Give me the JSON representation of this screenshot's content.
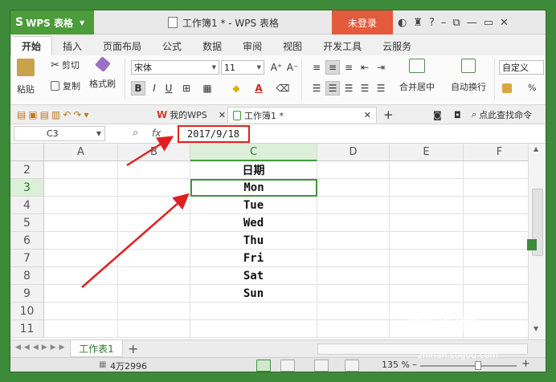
{
  "titlebar": {
    "app_name": "WPS 表格",
    "doc_title": "工作簿1 * - WPS 表格",
    "login_label": "未登录"
  },
  "ribbon_tabs": [
    "开始",
    "插入",
    "页面布局",
    "公式",
    "数据",
    "审阅",
    "视图",
    "开发工具",
    "云服务"
  ],
  "ribbon": {
    "paste": "粘贴",
    "cut": "剪切",
    "copy": "复制",
    "format_painter": "格式刷",
    "font_name": "宋体",
    "font_size": "11",
    "merge_center": "合并居中",
    "wrap_text": "自动换行",
    "number_format": "自定义",
    "percent": "%"
  },
  "doc_tabs": {
    "my_wps": "我的WPS",
    "workbook": "工作簿1 *",
    "search": "点此查找命令"
  },
  "formula_bar": {
    "cell_ref": "C3",
    "fx": "fx",
    "value": "2017/9/18"
  },
  "grid": {
    "columns": [
      "A",
      "B",
      "C",
      "D",
      "E",
      "F"
    ],
    "rows": [
      "2",
      "3",
      "4",
      "5",
      "6",
      "7",
      "8",
      "9",
      "10",
      "11"
    ],
    "c_values": [
      "日期",
      "Mon",
      "Tue",
      "Wed",
      "Thu",
      "Fri",
      "Sat",
      "Sun",
      "",
      ""
    ]
  },
  "sheet_tabs": {
    "active": "工作表1",
    "add": "+"
  },
  "statusbar": {
    "count": "4万2996",
    "zoom": "135 %"
  },
  "watermark": {
    "brand": "搜狗指南",
    "url": "zhinan.sogou.com"
  },
  "colors": {
    "accent_green": "#4b9c3a",
    "login_red": "#e35a3c",
    "highlight_red": "#e02020"
  }
}
